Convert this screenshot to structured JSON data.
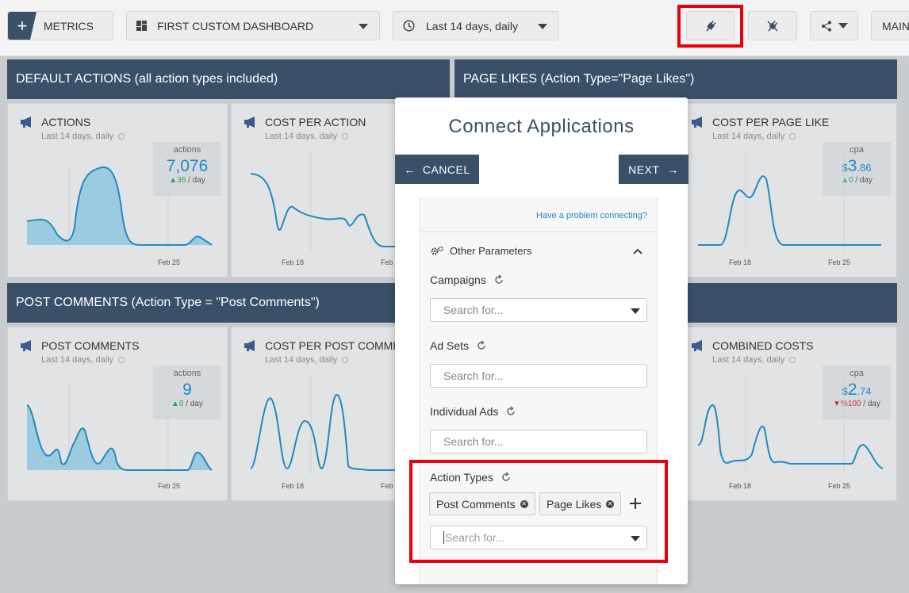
{
  "topbar": {
    "metrics_label": "METRICS",
    "plus_glyph": "+",
    "dashboard_label": "FIRST CUSTOM DASHBOARD",
    "range_label": "Last 14 days, daily",
    "main_label": "MAIN"
  },
  "sections": [
    {
      "title": "DEFAULT ACTIONS (all action types included)"
    },
    {
      "title": "PAGE LIKES (Action Type=\"Page Likes\")"
    },
    {
      "title": "POST COMMENTS (Action Type = \"Post Comments\")"
    }
  ],
  "cards": [
    {
      "title": "ACTIONS",
      "subtitle": "Last 14 days, daily",
      "kpi_label": "actions",
      "kpi_prefix": "",
      "kpi_value": "7,076",
      "kpi_decimals": "",
      "kpi_delta_arrow": "▲",
      "kpi_delta": "36",
      "kpi_unit": " / day",
      "xlabels": [
        "Feb 25"
      ]
    },
    {
      "title": "COST PER ACTION",
      "subtitle": "Last 14 days, daily",
      "xlabels": [
        "Feb 18",
        "Feb"
      ]
    },
    {
      "title": "COST PER PAGE LIKE",
      "subtitle": "Last 14 days, daily",
      "kpi_label": "cpa",
      "kpi_prefix": "$",
      "kpi_value": "3",
      "kpi_decimals": ".86",
      "kpi_delta_arrow": "▲",
      "kpi_delta": "0",
      "kpi_unit": " / day",
      "xlabels": [
        "Feb 18",
        "Feb 25"
      ]
    },
    {
      "title": "POST COMMENTS",
      "subtitle": "Last 14 days, daily",
      "kpi_label": "actions",
      "kpi_prefix": "",
      "kpi_value": "9",
      "kpi_decimals": "",
      "kpi_delta_arrow": "▲",
      "kpi_delta": "0",
      "kpi_unit": " / day",
      "xlabels": [
        "Feb 25"
      ]
    },
    {
      "title": "COST PER POST COMMEN",
      "subtitle": "Last 14 days, daily",
      "xlabels": [
        "Feb 18",
        "Feb"
      ]
    },
    {
      "title": "COMBINED COSTS",
      "subtitle": "Last 14 days, daily",
      "kpi_label": "cpa",
      "kpi_prefix": "$",
      "kpi_value": "2",
      "kpi_decimals": ".74",
      "kpi_delta_arrow": "▼",
      "kpi_delta": "%100",
      "kpi_unit": " / day",
      "xlabels": [
        "Feb 18",
        "Feb 25"
      ]
    }
  ],
  "modal": {
    "title": "Connect Applications",
    "cancel_label": "CANCEL",
    "next_label": "NEXT",
    "help_link": "Have a problem connecting?",
    "other_params_label": "Other Parameters",
    "campaigns_label": "Campaigns",
    "campaigns_placeholder": "Search for...",
    "adsets_label": "Ad Sets",
    "adsets_placeholder": "Search for...",
    "ads_label": "Individual Ads",
    "ads_placeholder": "Search for...",
    "action_types_label": "Action Types",
    "action_types_tags": [
      "Post Comments",
      "Page Likes"
    ],
    "action_types_placeholder": "Search for..."
  },
  "colors": {
    "accent": "#3a5068",
    "link": "#1e88c8",
    "highlight": "#e8000b",
    "chart_line": "#1f8ac0",
    "chart_fill": "#9ccbe0"
  }
}
